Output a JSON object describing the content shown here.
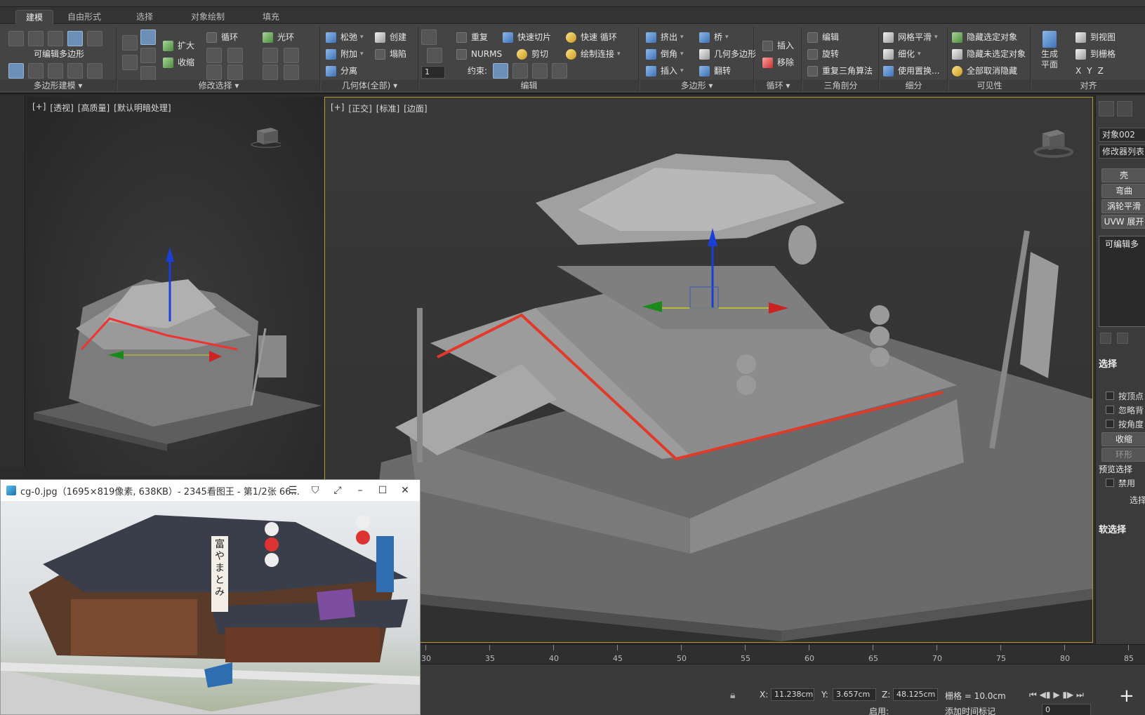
{
  "ribbon_tabs": [
    "建模",
    "自由形式",
    "选择",
    "对象绘制",
    "填充"
  ],
  "panels": {
    "poly_modeling": {
      "label": "可编辑多边形",
      "footer": "多边形建模 ▾"
    },
    "modify_select": {
      "items": [
        "扩大",
        "收缩",
        "循环",
        "光环"
      ],
      "footer": "修改选择 ▾"
    },
    "geometry": {
      "items": [
        "松弛",
        "附加",
        "分离",
        "创建",
        "塌陷"
      ],
      "footer": "几何体(全部) ▾"
    },
    "edit": {
      "items": [
        "重复",
        "快速切片",
        "快速 循环",
        "NURMS",
        "剪切",
        "绘制连接"
      ],
      "constraint_label": "约束:",
      "spinner_value": "1",
      "footer": "编辑"
    },
    "polygons": {
      "items": [
        "挤出",
        "桥",
        "倒角",
        "几何多边形",
        "插入",
        "翻转"
      ],
      "footer": "多边形 ▾"
    },
    "loops": {
      "items": [
        "插入",
        "移除"
      ],
      "footer": "循环 ▾"
    },
    "tris": {
      "items": [
        "编辑",
        "旋转",
        "重复三角算法"
      ],
      "footer": "三角剖分"
    },
    "subdivision": {
      "items": [
        "网格平滑",
        "细化",
        "使用置换..."
      ],
      "footer": "细分"
    },
    "visibility": {
      "items": [
        "隐藏选定对象",
        "隐藏未选定对象",
        "全部取消隐藏"
      ],
      "footer": "可见性"
    },
    "align": {
      "items": [
        "生成平面",
        "到视图",
        "到栅格"
      ],
      "axes": [
        "X",
        "Y",
        "Z"
      ],
      "footer": "对齐"
    }
  },
  "viewport_left": {
    "labels": [
      "[+]",
      "[透视]",
      "[高质量]",
      "[默认明暗处理]"
    ]
  },
  "viewport_main": {
    "labels": [
      "[+]",
      "[正交]",
      "[标准]",
      "[边面]"
    ]
  },
  "right_panel": {
    "object_name": "对象002",
    "modifier_list": "修改器列表",
    "buttons": [
      "壳",
      "弯曲",
      "涡轮平滑",
      "UVW 展开"
    ],
    "stack_item": "可编辑多",
    "selection_title": "选择",
    "checks": [
      "按顶点",
      "忽略背",
      "按角度"
    ],
    "shrink_btn": "收缩",
    "ring_btn": "环形",
    "preview_title": "预览选择",
    "preview_option": "禁用",
    "select_word": "选择",
    "soft_select": "软选择"
  },
  "timeline": {
    "ticks": [
      "30",
      "35",
      "40",
      "45",
      "50",
      "55",
      "60",
      "65",
      "70",
      "75",
      "80",
      "85"
    ]
  },
  "status": {
    "x_label": "X:",
    "x": "11.238cm",
    "y_label": "Y:",
    "y": "3.657cm",
    "z_label": "Z:",
    "z": "48.125cm",
    "grid": "栅格 = 10.0cm",
    "enable": "启用:",
    "add_key": "添加时间标记",
    "frame": "0"
  },
  "viewer": {
    "title": "cg-0.jpg（1695×819像素, 638KB）- 2345看图王 - 第1/2张 66...",
    "sign_text": "富やまとみ"
  }
}
